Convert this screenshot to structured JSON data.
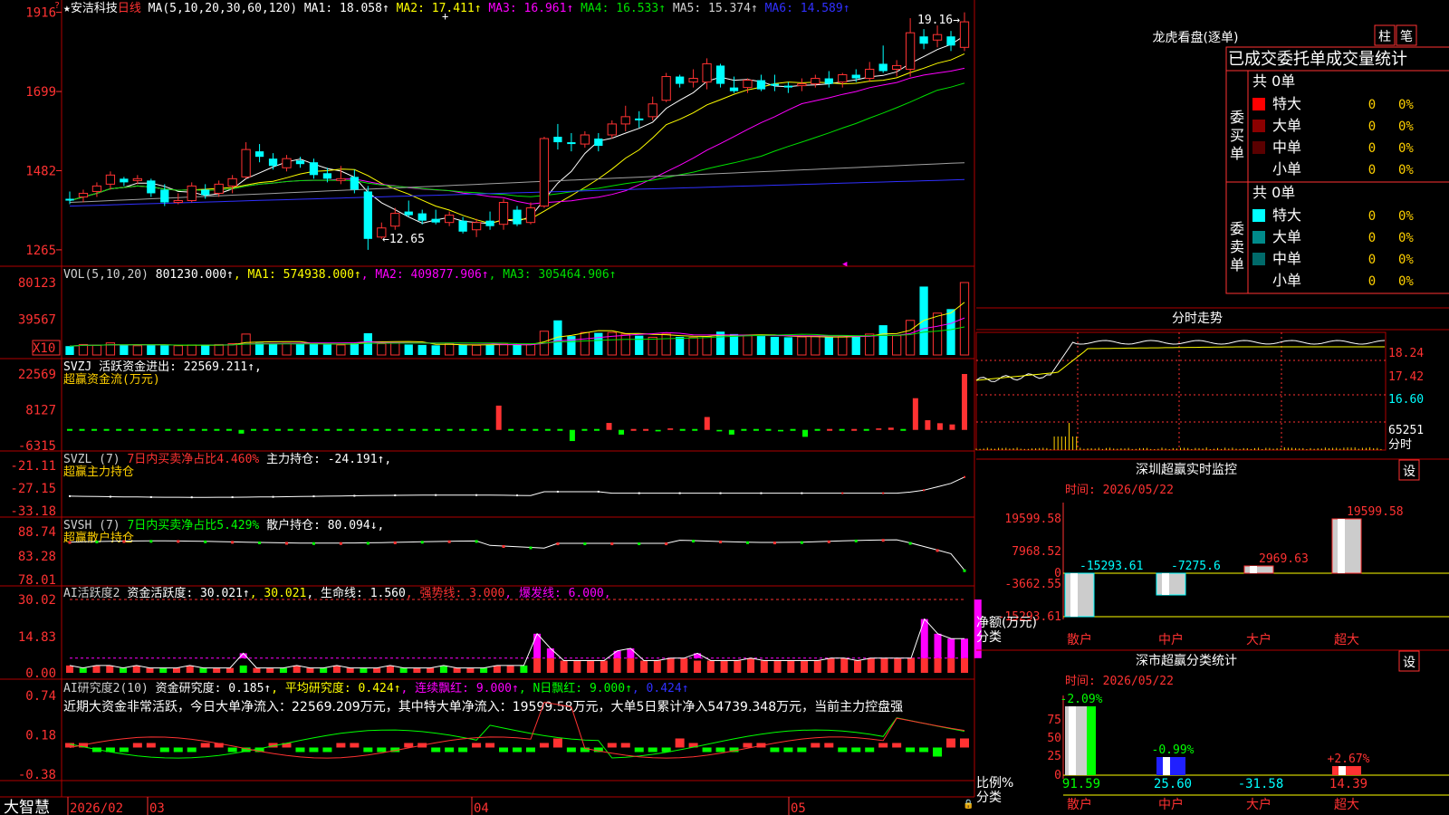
{
  "stock": {
    "name": "★安洁科技",
    "period": "日线"
  },
  "colors": {
    "up": "#ff3232",
    "down": "#00ffff",
    "bg": "#000000",
    "grid": "#b00000",
    "ma1": "#ffffff",
    "ma2": "#ffff00",
    "ma3": "#ff00ff",
    "ma4": "#00e000",
    "ma5": "#a0a0a0",
    "ma6": "#3030ff",
    "gold": "#ffd000",
    "green": "#00ff00",
    "cyan": "#00ffff",
    "magenta": "#ff00ff",
    "red": "#ff3232",
    "white": "#ffffff"
  },
  "main": {
    "header": [
      {
        "t": "★安洁科技",
        "c": "#ffffff"
      },
      {
        "t": "日线",
        "c": "#ff3232"
      },
      {
        "t": " MA(5,10,20,30,60,120) ",
        "c": "#ffffff"
      },
      {
        "t": "MA1: 18.058↑",
        "c": "#ffffff"
      },
      {
        "t": " MA2: 17.411↑",
        "c": "#ffff00"
      },
      {
        "t": " MA3: 16.961↑",
        "c": "#ff00ff"
      },
      {
        "t": " MA4: 16.533↑",
        "c": "#00e000"
      },
      {
        "t": " MA5: 15.374↑",
        "c": "#d0d0d0"
      },
      {
        "t": " MA6: 14.589↑",
        "c": "#3030ff"
      }
    ],
    "yticks": [
      "1916",
      "1699",
      "1482",
      "1265"
    ],
    "label_high": "19.16",
    "label_low": "12.65"
  },
  "vol": {
    "header": [
      {
        "t": "VOL(5,10,20) ",
        "c": "#d0d0d0"
      },
      {
        "t": "801230.000↑",
        "c": "#ffffff"
      },
      {
        "t": ", MA1: 574938.000↑",
        "c": "#ffff00"
      },
      {
        "t": ", MA2: 409877.906↑",
        "c": "#ff00ff"
      },
      {
        "t": ", MA3: 305464.906↑",
        "c": "#00e000"
      }
    ],
    "yticks": [
      "80123",
      "39567"
    ],
    "unit": "X10"
  },
  "svzj": {
    "header": [
      {
        "t": "SVZJ  活跃资金进出: 22569.211↑,",
        "c": "#ffffff"
      }
    ],
    "sub": "超赢资金流(万元)",
    "yticks": [
      "22569",
      "8127",
      "-6315"
    ]
  },
  "svzl": {
    "header": [
      {
        "t": "SVZL (7) ",
        "c": "#d0d0d0"
      },
      {
        "t": "7日内买卖净占比4.460%",
        "c": "#ff3232"
      },
      {
        "t": " 主力持仓: -24.191↑,",
        "c": "#ffffff"
      }
    ],
    "sub": "超赢主力持仓",
    "yticks": [
      "-21.11",
      "-27.15",
      "-33.18"
    ]
  },
  "svsh": {
    "header": [
      {
        "t": "SVSH (7) ",
        "c": "#d0d0d0"
      },
      {
        "t": "7日内买卖净占比5.429%",
        "c": "#00ff00"
      },
      {
        "t": " 散户持仓: 80.094↓,",
        "c": "#ffffff"
      }
    ],
    "sub": "超赢散户持仓",
    "yticks": [
      "88.74",
      "83.28",
      "78.01"
    ]
  },
  "ai1": {
    "header": [
      {
        "t": "AI活跃度2 ",
        "c": "#d0d0d0"
      },
      {
        "t": "资金活跃度: 30.021↑",
        "c": "#ffffff"
      },
      {
        "t": ", 30.021",
        "c": "#ffff00"
      },
      {
        "t": ", 生命线: 1.560",
        "c": "#ffffff"
      },
      {
        "t": ", 强势线: 3.000",
        "c": "#ff3232"
      },
      {
        "t": ", 爆发线: 6.000,",
        "c": "#ff00ff"
      }
    ],
    "yticks": [
      "30.02",
      "14.83",
      "0.00"
    ]
  },
  "ai2": {
    "header": [
      {
        "t": "AI研究度2(10) ",
        "c": "#d0d0d0"
      },
      {
        "t": "资金研究度: 0.185↑",
        "c": "#ffffff"
      },
      {
        "t": ", 平均研究度: 0.424↑",
        "c": "#ffff00"
      },
      {
        "t": ", 连续飘红: 9.000↑",
        "c": "#ff00ff"
      },
      {
        "t": ", N日飘红: 9.000↑",
        "c": "#00ff00"
      },
      {
        "t": ", 0.424↑",
        "c": "#3030ff"
      }
    ],
    "note": "近期大资金非常活跃，今日大单净流入：22569.209万元，其中特大单净流入：19599.58万元，大单5日累计净入54739.348万元，当前主力控盘强",
    "yticks": [
      "0.74",
      "0.18",
      "-0.38"
    ]
  },
  "bottom": {
    "logo": "大智慧",
    "dates": [
      "2026/02",
      "03",
      "04",
      "05"
    ]
  },
  "lhb": {
    "title": "龙虎看盘(逐单)",
    "btn1": "柱",
    "btn2": "笔",
    "subtitle": "已成交委托单成交量统计",
    "buy": {
      "side": "委买单",
      "total": "共 0单",
      "rows": [
        {
          "k": "特大",
          "v": "0",
          "p": "0%",
          "c": "#ff0000"
        },
        {
          "k": "大单",
          "v": "0",
          "p": "0%",
          "c": "#8b0000"
        },
        {
          "k": "中单",
          "v": "0",
          "p": "0%",
          "c": "#5a0000"
        },
        {
          "k": "小单",
          "v": "0",
          "p": "0%",
          "c": ""
        }
      ]
    },
    "sell": {
      "side": "委卖单",
      "total": "共 0单",
      "rows": [
        {
          "k": "特大",
          "v": "0",
          "p": "0%",
          "c": "#00ffff"
        },
        {
          "k": "大单",
          "v": "0",
          "p": "0%",
          "c": "#008b8b"
        },
        {
          "k": "中单",
          "v": "0",
          "p": "0%",
          "c": "#006a6a"
        },
        {
          "k": "小单",
          "v": "0",
          "p": "0%",
          "c": ""
        }
      ]
    }
  },
  "fenshi": {
    "title": "分时走势",
    "yticks": [
      "18.24",
      "17.42",
      "16.60",
      "65251"
    ],
    "unit": "分时"
  },
  "szmon": {
    "title": "深圳超赢实时监控",
    "btn": "设",
    "time": "时间: 2026/05/22",
    "yticks": [
      "19599.58",
      "7968.52",
      "0",
      "-3662.55",
      "-15293.61"
    ],
    "ylabel1": "净额(万元)",
    "ylabel2": "分类",
    "bars": [
      {
        "cat": "散户",
        "val": "-15293.61"
      },
      {
        "cat": "中户",
        "val": "-7275.6"
      },
      {
        "cat": "大户",
        "val": "2969.63"
      },
      {
        "cat": "超大",
        "val": "19599.58"
      }
    ]
  },
  "scstat": {
    "title": "深市超赢分类统计",
    "btn": "设",
    "time": "时间: 2026/05/22",
    "yticks": [
      "75",
      "50",
      "25",
      "0"
    ],
    "ylabel1": "比例%",
    "ylabel2": "分类",
    "bars": [
      {
        "cat": "散户",
        "top": "-2.09%",
        "bot": "91.59"
      },
      {
        "cat": "中户",
        "top": "-0.99%",
        "bot": "25.60"
      },
      {
        "cat": "大户",
        "top": "",
        "bot": "-31.58"
      },
      {
        "cat": "超大",
        "top": "+2.67%",
        "bot": "14.39"
      }
    ]
  },
  "chart_data": {
    "type": "candlestick",
    "candles": [
      [
        14.05,
        14.25,
        13.9,
        14.0
      ],
      [
        14.1,
        14.3,
        13.95,
        14.2
      ],
      [
        14.25,
        14.5,
        14.1,
        14.4
      ],
      [
        14.45,
        14.8,
        14.3,
        14.7
      ],
      [
        14.6,
        14.65,
        14.4,
        14.5
      ],
      [
        14.55,
        14.7,
        14.45,
        14.6
      ],
      [
        14.55,
        14.6,
        14.1,
        14.2
      ],
      [
        14.3,
        14.45,
        13.85,
        13.95
      ],
      [
        13.95,
        14.2,
        13.9,
        14.0
      ],
      [
        14.0,
        14.5,
        13.95,
        14.4
      ],
      [
        14.3,
        14.45,
        14.05,
        14.15
      ],
      [
        14.2,
        14.55,
        14.1,
        14.45
      ],
      [
        14.4,
        14.7,
        14.2,
        14.6
      ],
      [
        14.65,
        15.6,
        14.6,
        15.4
      ],
      [
        15.35,
        15.55,
        15.05,
        15.2
      ],
      [
        15.15,
        15.3,
        14.85,
        14.95
      ],
      [
        14.9,
        15.25,
        14.8,
        15.15
      ],
      [
        15.1,
        15.2,
        14.9,
        15.0
      ],
      [
        15.05,
        15.15,
        14.6,
        14.7
      ],
      [
        14.75,
        14.9,
        14.5,
        14.6
      ],
      [
        14.55,
        14.95,
        14.45,
        14.6
      ],
      [
        14.65,
        14.85,
        14.2,
        14.3
      ],
      [
        14.25,
        14.4,
        12.65,
        12.95
      ],
      [
        13.0,
        13.4,
        12.95,
        13.25
      ],
      [
        13.3,
        13.8,
        13.2,
        13.65
      ],
      [
        13.7,
        14.0,
        13.55,
        13.6
      ],
      [
        13.65,
        13.75,
        13.35,
        13.45
      ],
      [
        13.5,
        13.75,
        13.35,
        13.4
      ],
      [
        13.4,
        13.7,
        13.3,
        13.6
      ],
      [
        13.45,
        13.55,
        13.1,
        13.15
      ],
      [
        13.2,
        13.5,
        13.0,
        13.4
      ],
      [
        13.45,
        13.7,
        13.2,
        13.3
      ],
      [
        13.35,
        14.05,
        13.2,
        13.95
      ],
      [
        13.75,
        13.85,
        13.3,
        13.35
      ],
      [
        13.4,
        13.95,
        13.35,
        13.8
      ],
      [
        13.85,
        15.75,
        13.8,
        15.7
      ],
      [
        15.75,
        16.1,
        15.4,
        15.6
      ],
      [
        15.6,
        15.85,
        15.35,
        15.55
      ],
      [
        15.55,
        15.9,
        15.45,
        15.8
      ],
      [
        15.7,
        15.85,
        15.35,
        15.5
      ],
      [
        15.8,
        16.2,
        15.7,
        16.1
      ],
      [
        16.1,
        16.6,
        15.9,
        16.3
      ],
      [
        16.25,
        16.45,
        16.0,
        16.2
      ],
      [
        16.3,
        16.85,
        16.2,
        16.65
      ],
      [
        16.75,
        17.5,
        16.7,
        17.4
      ],
      [
        17.4,
        17.45,
        17.1,
        17.2
      ],
      [
        17.25,
        17.6,
        17.1,
        17.35
      ],
      [
        17.25,
        17.9,
        17.05,
        17.75
      ],
      [
        17.7,
        17.75,
        17.1,
        17.2
      ],
      [
        17.1,
        17.4,
        16.95,
        17.0
      ],
      [
        17.1,
        17.35,
        16.95,
        17.3
      ],
      [
        17.3,
        17.45,
        17.0,
        17.05
      ],
      [
        17.2,
        17.45,
        17.0,
        17.15
      ],
      [
        17.15,
        17.25,
        16.95,
        17.1
      ],
      [
        17.15,
        17.35,
        17.0,
        17.2
      ],
      [
        17.2,
        17.45,
        17.1,
        17.35
      ],
      [
        17.35,
        17.55,
        17.1,
        17.2
      ],
      [
        17.25,
        17.5,
        17.1,
        17.45
      ],
      [
        17.45,
        17.6,
        17.25,
        17.35
      ],
      [
        17.35,
        17.8,
        17.25,
        17.6
      ],
      [
        17.75,
        18.25,
        17.5,
        17.55
      ],
      [
        17.6,
        17.85,
        17.4,
        17.7
      ],
      [
        17.6,
        19.0,
        17.4,
        18.6
      ],
      [
        18.5,
        18.7,
        18.15,
        18.3
      ],
      [
        18.4,
        18.8,
        18.2,
        18.55
      ],
      [
        18.5,
        18.65,
        18.1,
        18.25
      ],
      [
        18.2,
        19.16,
        18.1,
        18.9
      ]
    ],
    "volume": [
      220,
      260,
      240,
      300,
      250,
      230,
      260,
      240,
      230,
      250,
      240,
      260,
      280,
      520,
      300,
      280,
      290,
      270,
      280,
      260,
      250,
      300,
      540,
      280,
      300,
      260,
      250,
      240,
      270,
      250,
      240,
      260,
      270,
      250,
      260,
      590,
      860,
      470,
      560,
      550,
      560,
      520,
      480,
      440,
      520,
      450,
      440,
      460,
      580,
      520,
      480,
      470,
      450,
      440,
      450,
      460,
      440,
      450,
      470,
      520,
      740,
      480,
      860,
      1700,
      1040,
      1140,
      1800
    ],
    "svzj": [
      -200,
      -200,
      -200,
      -200,
      -200,
      -200,
      -200,
      -200,
      -200,
      -200,
      -200,
      -200,
      -200,
      -200,
      -1500,
      -200,
      -200,
      -200,
      -200,
      -200,
      -200,
      -200,
      -200,
      -200,
      -200,
      -200,
      -200,
      -200,
      -200,
      -200,
      -200,
      -200,
      -200,
      -200,
      -200,
      9800,
      -200,
      -200,
      -200,
      -200,
      -200,
      -4500,
      -200,
      -200,
      2800,
      -1900,
      200,
      300,
      -600,
      600,
      -300,
      -300,
      5200,
      -600,
      -1900,
      -300,
      -200,
      -200,
      -600,
      -200,
      -2800,
      -300,
      200,
      -200,
      300,
      -200,
      600,
      900,
      -300,
      12800,
      3900,
      2700,
      2200,
      22569
    ],
    "ai1_red": [
      3,
      2,
      3,
      3,
      2,
      3,
      2,
      2,
      2,
      3,
      2,
      2,
      2,
      3,
      2,
      2,
      2,
      3,
      2,
      2,
      3,
      2,
      2,
      2,
      3,
      2,
      2,
      2,
      3,
      2,
      2,
      2,
      3,
      3,
      3,
      6,
      6,
      5,
      5,
      5,
      5,
      6,
      6,
      5,
      5,
      6,
      6,
      5,
      5,
      5,
      5,
      6,
      5,
      5,
      5,
      5,
      5,
      6,
      6,
      5,
      6,
      6,
      6,
      6,
      6,
      6,
      6,
      6
    ],
    "ai1_mag": [
      0,
      0,
      0,
      0,
      0,
      0,
      0,
      0,
      0,
      0,
      0,
      0,
      0,
      8,
      0,
      0,
      0,
      0,
      0,
      0,
      0,
      0,
      0,
      0,
      0,
      0,
      0,
      0,
      0,
      0,
      0,
      0,
      0,
      0,
      0,
      16,
      10,
      0,
      0,
      0,
      0,
      9,
      10,
      0,
      0,
      0,
      0,
      8,
      0,
      0,
      0,
      0,
      0,
      0,
      0,
      0,
      0,
      0,
      0,
      0,
      0,
      0,
      0,
      0,
      22,
      16,
      14,
      14,
      30
    ]
  }
}
